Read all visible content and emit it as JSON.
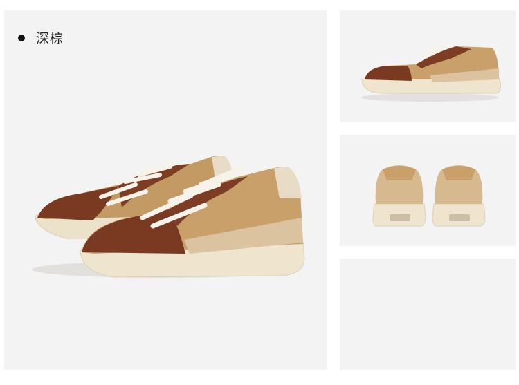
{
  "color_option": {
    "label": "深棕"
  },
  "colors": {
    "panel_bg": "#f3f3f3",
    "dark_brown_suede": "#7a3a22",
    "tan_suede": "#c49a64",
    "light_sand": "#d8bf9a",
    "sole_cream": "#efe5cf",
    "lace_white": "#f7f3ea"
  },
  "images": {
    "main": "sneaker-pair-hero",
    "thumb_side": "sneaker-side-view",
    "thumb_back": "sneaker-back-view",
    "thumb_empty": "empty-thumbnail"
  }
}
